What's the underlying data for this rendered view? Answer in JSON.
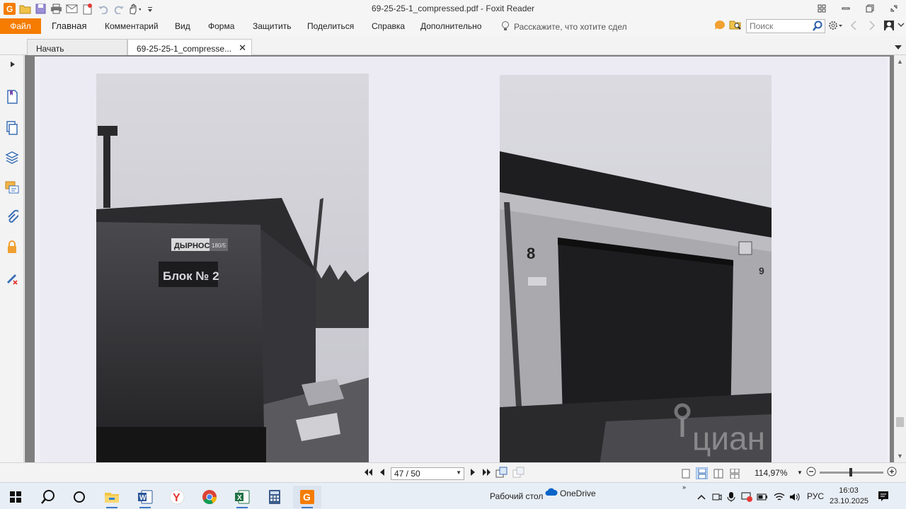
{
  "window": {
    "title": "69-25-25-1_compressed.pdf - Foxit Reader",
    "accent_color": "#f57c00"
  },
  "ribbon": {
    "file_tab": "Файл",
    "tabs": [
      "Главная",
      "Комментарий",
      "Вид",
      "Форма",
      "Защитить",
      "Поделиться",
      "Справка",
      "Дополнительно"
    ],
    "tell_me": "Расскажите, что хотите сдел",
    "search_placeholder": "Поиск"
  },
  "doc_tabs": [
    {
      "label": "Начать",
      "active": false
    },
    {
      "label": "69-25-25-1_compresse...",
      "active": true
    }
  ],
  "left_panel_icons": [
    "bookmark-icon",
    "pages-icon",
    "layers-icon",
    "comments-icon",
    "attachments-icon",
    "security-icon",
    "signature-icon"
  ],
  "document": {
    "photo_left_signs": [
      "ДЫРНОС",
      "Блок № 2"
    ],
    "photo_left_sign_tag": "180/5",
    "photo_right_marks": [
      "8",
      "9"
    ],
    "watermark": "циан"
  },
  "status": {
    "page_value": "47 / 50",
    "zoom": "114,97%",
    "zoom_level_fraction": 0.47
  },
  "taskbar": {
    "apps": [
      "file-explorer-icon",
      "word-icon",
      "yandex-browser-icon",
      "chrome-icon",
      "excel-icon",
      "calculator-icon",
      "foxit-reader-icon"
    ],
    "desktop_label": "Рабочий стол",
    "onedrive_label": "OneDrive",
    "language": "РУС",
    "time": "16:03",
    "date": "23.10.2025"
  }
}
